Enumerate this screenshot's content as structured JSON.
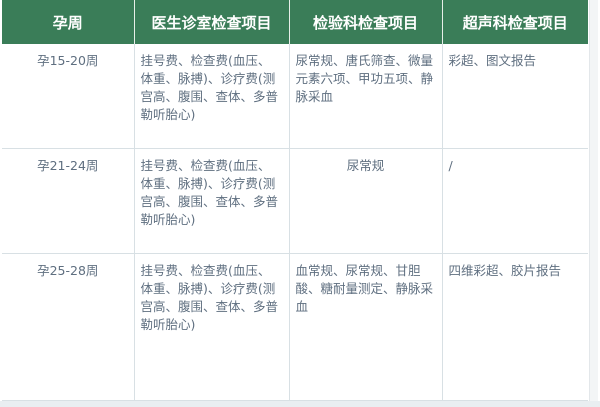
{
  "table": {
    "headers": [
      "孕周",
      "医生诊室检查项目",
      "检验科检查项目",
      "超声科检查项目"
    ],
    "rows": [
      {
        "week": "孕15-20周",
        "doctor": "挂号费、检查费(血压、体重、脉搏)、诊疗费(测宫高、腹围、查体、多普勒听胎心)",
        "lab": "尿常规、唐氏筛查、微量元素六项、甲功五项、静脉采血",
        "ultrasound": "彩超、图文报告"
      },
      {
        "week": "孕21-24周",
        "doctor": "挂号费、检查费(血压、体重、脉搏)、诊疗费(测宫高、腹围、查体、多普勒听胎心)",
        "lab": "尿常规",
        "ultrasound": "/"
      },
      {
        "week": "孕25-28周",
        "doctor": "挂号费、检查费(血压、体重、脉搏)、诊疗费(测宫高、腹围、查体、多普勒听胎心)",
        "lab": "血常规、尿常规、甘胆酸、糖耐量测定、静脉采血",
        "ultrasound": "四维彩超、胶片报告"
      }
    ]
  },
  "colors": {
    "header_bg": "#3a7d58",
    "header_text": "#ffffff",
    "cell_text": "#5f6f80",
    "border": "#d8e0e4"
  }
}
